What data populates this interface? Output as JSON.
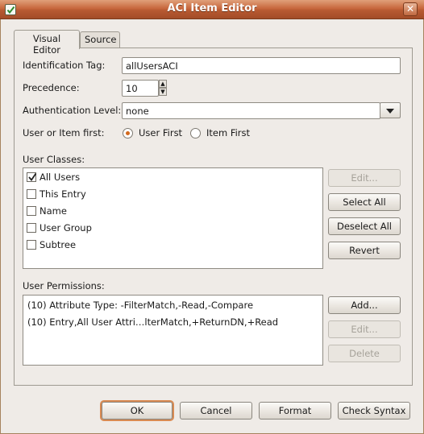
{
  "window": {
    "title": "ACI Item Editor",
    "close_label": "✕"
  },
  "tabs": [
    {
      "label": "Visual Editor",
      "active": true
    },
    {
      "label": "Source",
      "active": false
    }
  ],
  "form": {
    "identification_tag": {
      "label": "Identification Tag:",
      "value": "allUsersACI"
    },
    "precedence": {
      "label": "Precedence:",
      "value": "10"
    },
    "authentication_level": {
      "label": "Authentication Level:",
      "value": "none"
    },
    "user_or_item_first": {
      "label": "User or Item first:",
      "options": [
        {
          "label": "User First",
          "selected": true
        },
        {
          "label": "Item First",
          "selected": false
        }
      ]
    }
  },
  "user_classes": {
    "label": "User Classes:",
    "items": [
      {
        "label": "All Users",
        "checked": true
      },
      {
        "label": "This Entry",
        "checked": false
      },
      {
        "label": "Name",
        "checked": false
      },
      {
        "label": "User Group",
        "checked": false
      },
      {
        "label": "Subtree",
        "checked": false
      }
    ],
    "buttons": {
      "edit": "Edit...",
      "select_all": "Select All",
      "deselect_all": "Deselect All",
      "revert": "Revert"
    }
  },
  "user_permissions": {
    "label": "User Permissions:",
    "items": [
      "(10) Attribute Type: -FilterMatch,-Read,-Compare",
      "(10) Entry,All User Attri…lterMatch,+ReturnDN,+Read"
    ],
    "buttons": {
      "add": "Add...",
      "edit": "Edit...",
      "delete": "Delete"
    }
  },
  "footer": {
    "ok": "OK",
    "cancel": "Cancel",
    "format": "Format",
    "check_syntax": "Check Syntax"
  },
  "colors": {
    "titlebar": "#b85a32",
    "window_bg": "#efebe7",
    "radio_accent": "#d2691e"
  },
  "icons": {
    "window_icon": "checkbox-icon",
    "combo_arrow": "chevron-down-icon"
  }
}
